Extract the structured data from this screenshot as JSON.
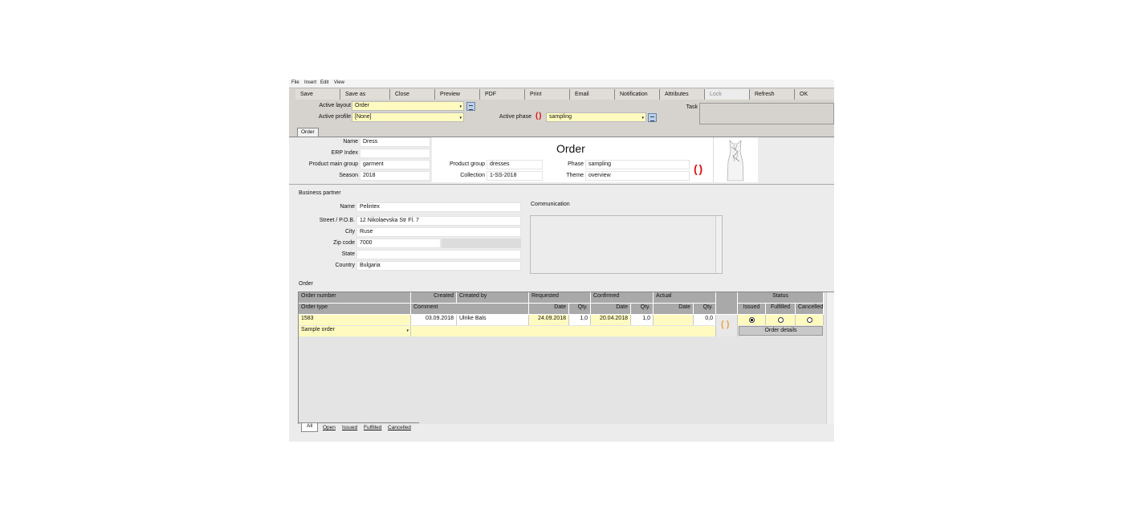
{
  "menu": [
    "File",
    "Insert",
    "Edit",
    "View"
  ],
  "toolbar": [
    "Save",
    "Save as",
    "Close",
    "Preview",
    "PDF",
    "Print",
    "Email",
    "Notification",
    "Attributes",
    "Lock",
    "Refresh",
    "OK"
  ],
  "top_form": {
    "active_layout_label": "Active layout",
    "active_layout_value": "Order",
    "active_profile_label": "Active profile",
    "active_profile_value": "[None]",
    "active_phase_label": "Active phase",
    "active_phase_value": "sampling",
    "task_label": "Task"
  },
  "tabs": [
    "Order"
  ],
  "header": {
    "title": "Order",
    "name_label": "Name",
    "name_value": "Dress",
    "erp_label": "ERP Index",
    "erp_value": "",
    "main_group_label": "Product main group",
    "main_group_value": "garment",
    "season_label": "Season",
    "season_value": "2018",
    "product_group_label": "Product group",
    "product_group_value": "dresses",
    "collection_label": "Collection",
    "collection_value": "1-SS-2018",
    "phase_label": "Phase",
    "phase_value": "sampling",
    "theme_label": "Theme",
    "theme_value": "overview"
  },
  "business_partner": {
    "section_title": "Business partner",
    "name_label": "Name",
    "name_value": "Pelintex",
    "street_label": "Street / P.O.B.",
    "street_value": "12 Nikolaevska Str Fl. 7",
    "city_label": "City",
    "city_value": "Ruse",
    "zip_label": "Zip code",
    "zip_value": "7000",
    "state_label": "State",
    "state_value": "",
    "country_label": "Country",
    "country_value": "Bulgaria",
    "communication_label": "Communication"
  },
  "order_section": {
    "title": "Order",
    "headers_row1": {
      "order_number": "Order number",
      "created": "Created",
      "created_by": "Created by",
      "requested": "Requested",
      "confirmed": "Confirmed",
      "actual": "Actual",
      "status": "Status"
    },
    "headers_row2": {
      "order_type": "Order type",
      "comment": "Comment",
      "req_date": "Date",
      "req_qty": "Qty.",
      "conf_date": "Date",
      "conf_qty": "Qty.",
      "act_date": "Date",
      "act_qty": "Qty.",
      "issued": "Issued",
      "fulfilled": "Fulfilled",
      "cancelled": "Cancelled"
    },
    "row": {
      "order_number": "1583",
      "created": "03.09.2018",
      "created_by": "Ulrike Bals",
      "req_date": "24.09.2018",
      "req_qty": "1,0",
      "conf_date": "20.04.2018",
      "conf_qty": "1,0",
      "act_date": "",
      "act_qty": "0,0",
      "order_type": "Sample order",
      "comment": "",
      "status_selected": "Issued"
    },
    "order_details_button": "Order details"
  },
  "bottom_tabs": [
    "All",
    "Open",
    "Issued",
    "Fulfilled",
    "Cancelled"
  ],
  "colors": {
    "field_yellow": "#fffbc0",
    "toolbar_bg": "#d6d3ce",
    "header_grey": "#a9a9a9",
    "phase_red": "#dd1111",
    "status_orange": "#f0a040"
  }
}
